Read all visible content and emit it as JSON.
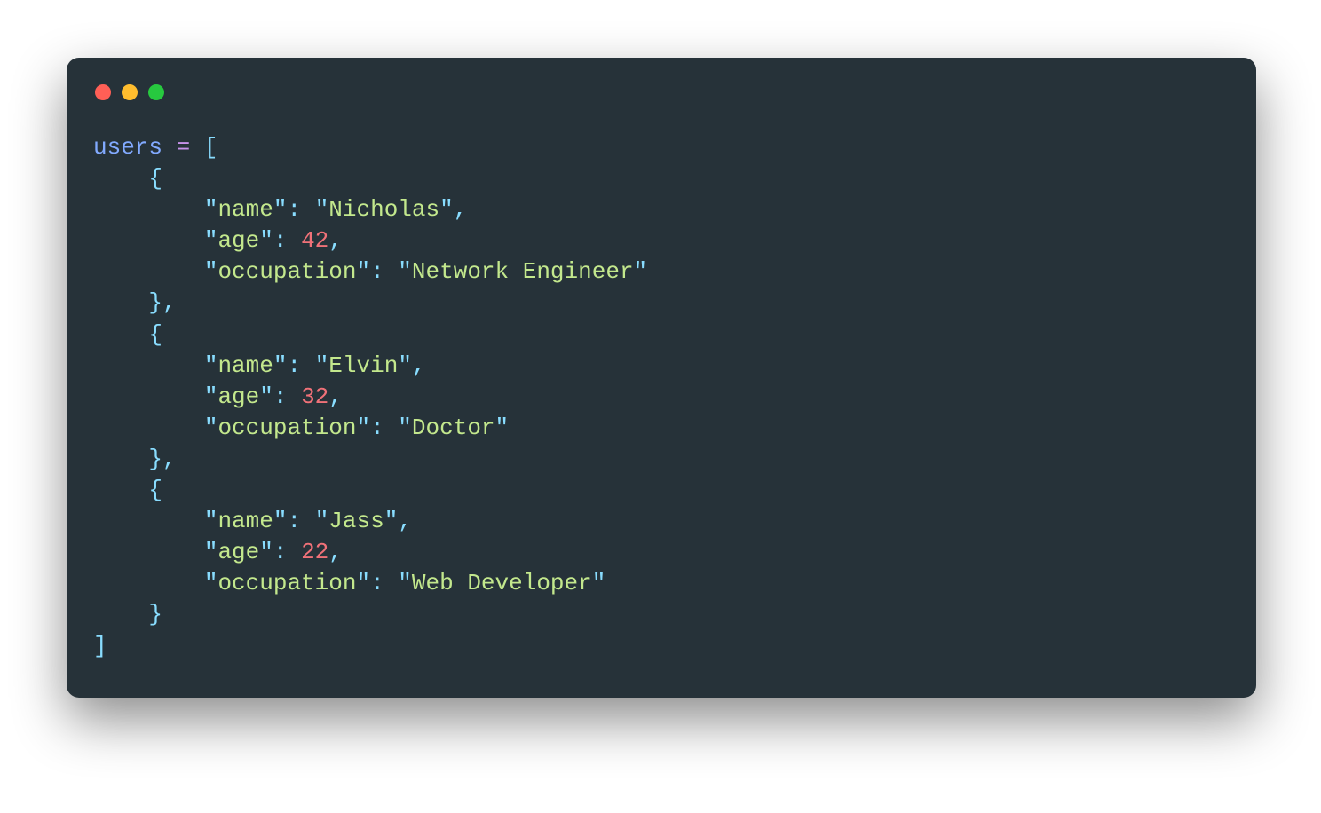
{
  "code": {
    "variable_name": "users",
    "users": [
      {
        "name": "Nicholas",
        "age": 42,
        "occupation": "Network Engineer"
      },
      {
        "name": "Elvin",
        "age": 32,
        "occupation": "Doctor"
      },
      {
        "name": "Jass",
        "age": 22,
        "occupation": "Web Developer"
      }
    ],
    "keys": {
      "name": "name",
      "age": "age",
      "occupation": "occupation"
    }
  },
  "window": {
    "traffic_light_colors": {
      "red": "#ff5f56",
      "yellow": "#ffbd2e",
      "green": "#27c93f"
    }
  }
}
